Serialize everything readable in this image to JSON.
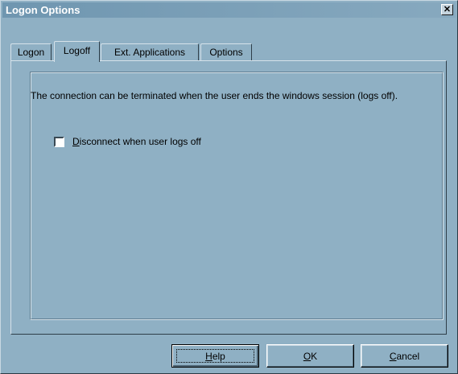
{
  "window": {
    "title": "Logon Options",
    "close_label": "✕"
  },
  "tabs": [
    {
      "label": "Logon",
      "active": false
    },
    {
      "label": "Logoff",
      "active": true
    },
    {
      "label": "Ext. Applications",
      "active": false
    },
    {
      "label": "Options",
      "active": false
    }
  ],
  "logoff_tab": {
    "description": "The connection can be terminated when the user ends the windows session (logs off).",
    "disconnect_checkbox": {
      "label_accesskey": "D",
      "label_rest": "isconnect when user logs off",
      "checked": false
    }
  },
  "buttons": {
    "help": {
      "accesskey": "H",
      "rest": "elp"
    },
    "ok": {
      "accesskey": "O",
      "rest": "K"
    },
    "cancel": {
      "accesskey": "C",
      "rest": "ancel"
    }
  },
  "colors": {
    "dialog_bg": "#8fb0c4",
    "titlebar": "#6f96b0",
    "title_text": "#ffffff"
  }
}
